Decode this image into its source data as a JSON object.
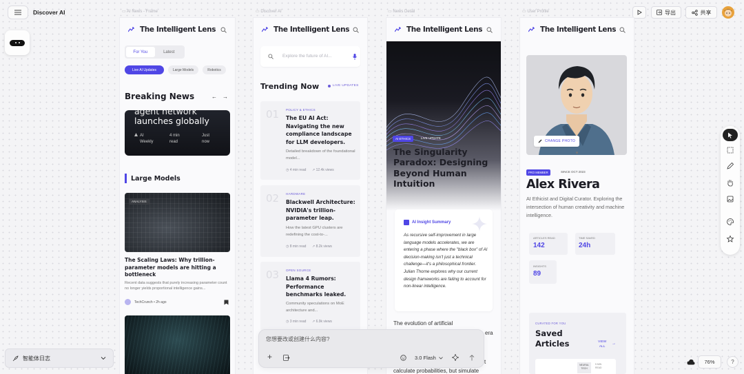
{
  "app": {
    "title": "Discover AI",
    "export_label": "导出",
    "share_label": "共享",
    "zoom": "76%",
    "agent_log_label": "智能体日志"
  },
  "frames": {
    "f1": "AI News - Frame",
    "f2": "Discover AI",
    "f3": "News Detail",
    "f4": "User Profile"
  },
  "brand": "The Intelligent Lens",
  "feed": {
    "tabs": [
      "For You",
      "Latest"
    ],
    "chips": [
      "Live AI Updates",
      "Large Models",
      "Robotics"
    ],
    "breaking_title": "Breaking News",
    "hero_line1": "agent network",
    "hero_line2": "launches globally",
    "hero_source_1": "AI",
    "hero_source_2": "Weekly",
    "hero_read_1": "4 min",
    "hero_read_2": "read",
    "hero_time_1": "Just",
    "hero_time_2": "now",
    "section_title": "Large Models",
    "badge": "ANALYSIS",
    "article_title": "The Scaling Laws: Why trillion-parameter models are hitting a bottleneck",
    "article_excerpt": "Recent data suggests that purely increasing parameter count no longer yields proportional intelligence gains...",
    "article_meta": "TechCrunch • 2h ago"
  },
  "discover": {
    "search_placeholder": "Explore the future of AI...",
    "trending_title": "Trending Now",
    "live_label": "LIVE UPDATES",
    "items": [
      {
        "num": "01",
        "kicker": "POLICY & ETHICS",
        "title": "The EU AI Act: Navigating the new compliance landscape for LLM developers.",
        "excerpt": "Detailed breakdown of the foundational model...",
        "read": "4 min read",
        "views": "12.4k views"
      },
      {
        "num": "02",
        "kicker": "HARDWARE",
        "title": "Blackwell Architecture: NVIDIA's trillion-parameter leap.",
        "excerpt": "How the latest GPU clusters are redefining the cost-to-...",
        "read": "8 min read",
        "views": "8.2k views"
      },
      {
        "num": "03",
        "kicker": "OPEN SOURCE",
        "title": "Llama 4 Rumors: Performance benchmarks leaked.",
        "excerpt": "Community speculations on MoE architecture and...",
        "read": "3 min read",
        "views": "6.9k views"
      }
    ]
  },
  "detail": {
    "tag1": "AI ETHICS",
    "tag2": "LIVE UPDATE",
    "title": "The Singularity Paradox: Designing Beyond Human Intuition",
    "insight_label": "AI Insight Summary",
    "insight_text": "As recursive self-improvement in large language models accelerates, we are entering a phase where the \"black box\" of AI decision-making isn't just a technical challenge—it's a philosophical frontier. Julian Thorne explores why our current design frameworks are failing to account for non-linear intelligence.",
    "body_1": "The evolution of artificial",
    "body_1b": "era",
    "body_2": "t",
    "body_3": "calculate probabilities, but simulate"
  },
  "profile": {
    "change_photo": "CHANGE PHOTO",
    "badge": "PRO MEMBER",
    "since": "SINCE OCT 2023",
    "name": "Alex Rivera",
    "bio": "AI Ethicist and Digital Curator. Exploring the intersection of human creativity and machine intelligence.",
    "stats": [
      {
        "label": "ARTICLES READ",
        "value": "142"
      },
      {
        "label": "TIME SAVED",
        "value": "24h"
      },
      {
        "label": "INSIGHTS",
        "value": "89"
      }
    ],
    "curated_label": "CURATED FOR YOU",
    "saved_1": "Saved",
    "saved_2": "Articles",
    "view_all_1": "VIEW",
    "view_all_2": "ALL",
    "mini_1": "NEURAL",
    "mini_2": "TECH",
    "mini_3": "5 MIN",
    "mini_4": "READ"
  },
  "prompt": {
    "placeholder": "您想要改或创建什么内容?",
    "model": "3.0 Flash"
  },
  "colors": {
    "accent": "#4f46e5",
    "purple": "#6b5bd8",
    "dark": "#1c1c24"
  }
}
